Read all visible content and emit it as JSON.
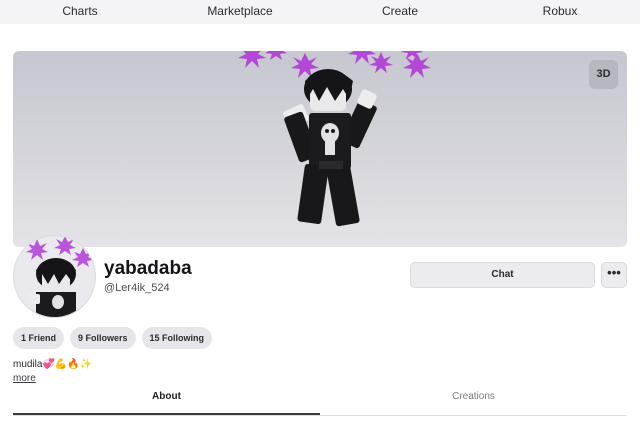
{
  "nav": {
    "items": [
      "Charts",
      "Marketplace",
      "Create",
      "Robux"
    ]
  },
  "banner": {
    "view_3d_label": "3D"
  },
  "profile": {
    "display_name": "yabadaba",
    "username": "@Ler4ik_524"
  },
  "actions": {
    "chat_label": "Chat",
    "more_label": "•••"
  },
  "stats": {
    "friends": "1 Friend",
    "followers": "9 Followers",
    "following": "15 Following"
  },
  "bio": {
    "text": "mudila💞💪🔥✨",
    "more_link": "more"
  },
  "tabs": {
    "about": "About",
    "creations": "Creations"
  },
  "colors": {
    "banner_bg": "#cfcfd6",
    "accent_sparkle": "#b03bd6"
  }
}
